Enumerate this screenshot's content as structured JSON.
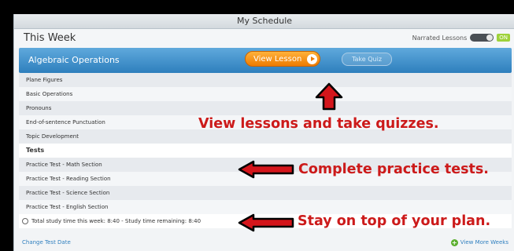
{
  "window": {
    "title": "My Schedule"
  },
  "header": {
    "week_title": "This Week",
    "narrated_label": "Narrated Lessons",
    "narrated_state": "ON"
  },
  "lesson_bar": {
    "title": "Algebraic Operations",
    "view_lesson": "View Lesson",
    "take_quiz": "Take Quiz",
    "color": "#2e7fbd"
  },
  "lessons": [
    "Plane Figures",
    "Basic Operations",
    "Pronouns",
    "End-of-sentence Punctuation",
    "Topic Development"
  ],
  "tests": {
    "heading": "Tests",
    "items": [
      "Practice Test - Math Section",
      "Practice Test - Reading Section",
      "Practice Test - Science Section",
      "Practice Test - English Section"
    ]
  },
  "total": "Total study time this week: 8:40 - Study time remaining: 8:40",
  "footer": {
    "change_date": "Change Test Date",
    "view_more": "View More Weeks"
  },
  "callouts": {
    "lessons": "View lessons and take quizzes.",
    "tests": "Complete practice tests.",
    "plan": "Stay on top of your plan.",
    "color": "#cc1a1a"
  }
}
